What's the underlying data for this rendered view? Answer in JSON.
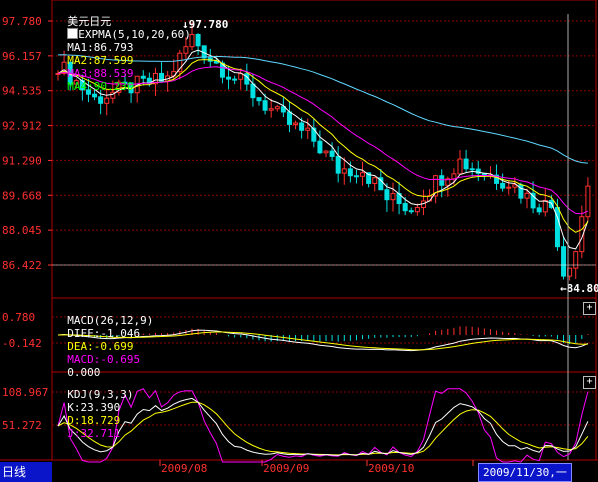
{
  "main": {
    "symbol": "美元日元",
    "indicator_name": "EXPMA(5,10,20,60)",
    "ma1": "MA1:86.793",
    "ma2": "MA2:87.599",
    "ma3": "MA3:88.539",
    "ma4": "MA4:90.230",
    "high_label": "97.780",
    "low_label": "84.800",
    "axis": [
      "97.780",
      "96.157",
      "94.535",
      "92.912",
      "91.290",
      "89.668",
      "88.045",
      "86.422"
    ]
  },
  "macd": {
    "name": "MACD(26,12,9)",
    "diff": "DIFF:-1.046",
    "dea": "DEA:-0.699",
    "macd": "MACD:-0.695",
    "extra": "0.000",
    "axis": [
      "0.780",
      "-0.142"
    ]
  },
  "kdj": {
    "name": "KDJ(9,3,3)",
    "k": "K:23.390",
    "d": "D:18.729",
    "j": "J:32.711",
    "axis": [
      "108.967",
      "51.272"
    ]
  },
  "footer": {
    "period": "日线",
    "dates": [
      "2009/08",
      "2009/09",
      "2009/10"
    ],
    "cursor_date": "2009/11/30,一"
  },
  "colors": {
    "up": "#ff3030",
    "down": "#00e0e0",
    "ma1": "#ffffff",
    "ma2": "#ffff00",
    "ma3": "#ff00ff",
    "ma4": "#00ff00",
    "ma4_line": "#5fd8ff",
    "grid": "#8b0000",
    "frame": "#b00000"
  }
}
